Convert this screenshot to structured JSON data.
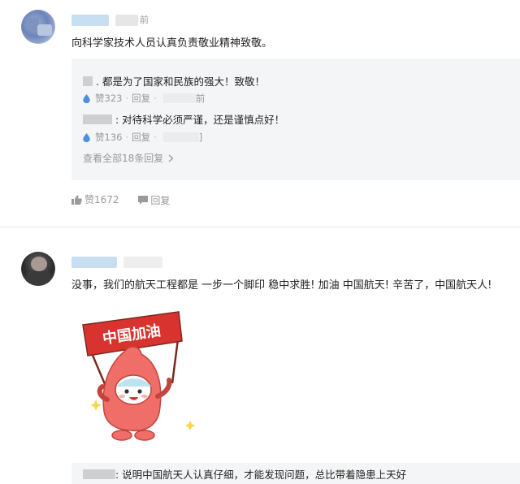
{
  "comment1": {
    "time_suffix": "前",
    "text": "向科学家技术人员认真负责敬业精神致敬。",
    "replies": [
      {
        "text": ". 都是为了国家和民族的强大！致敬！",
        "likes": "赞323",
        "reply_label": "回复",
        "time_suffix": "前"
      },
      {
        "text": ": 对待科学必须严谨，还是谨慎点好！",
        "likes": "赞136",
        "reply_label": "回复",
        "time_suffix": "]"
      }
    ],
    "view_all": "查看全部18条回复",
    "actions": {
      "like_count": "赞1672",
      "reply_label": "回复"
    }
  },
  "comment2": {
    "text": "没事，我们的航天工程都是 一步一个脚印 稳中求胜! 加油 中国航天! 辛苦了，中国航天人!",
    "sticker": {
      "banner_text": "中国加油"
    },
    "reply_preview": ": 说明中国航天人认真仔细，才能发现问题，总比带着隐患上天好"
  },
  "colors": {
    "accent": "#4a90e2",
    "muted": "#999999",
    "reply_bg": "#f4f5f6",
    "banner_red": "#d9332f",
    "sticker_body": "#ef6f68"
  }
}
